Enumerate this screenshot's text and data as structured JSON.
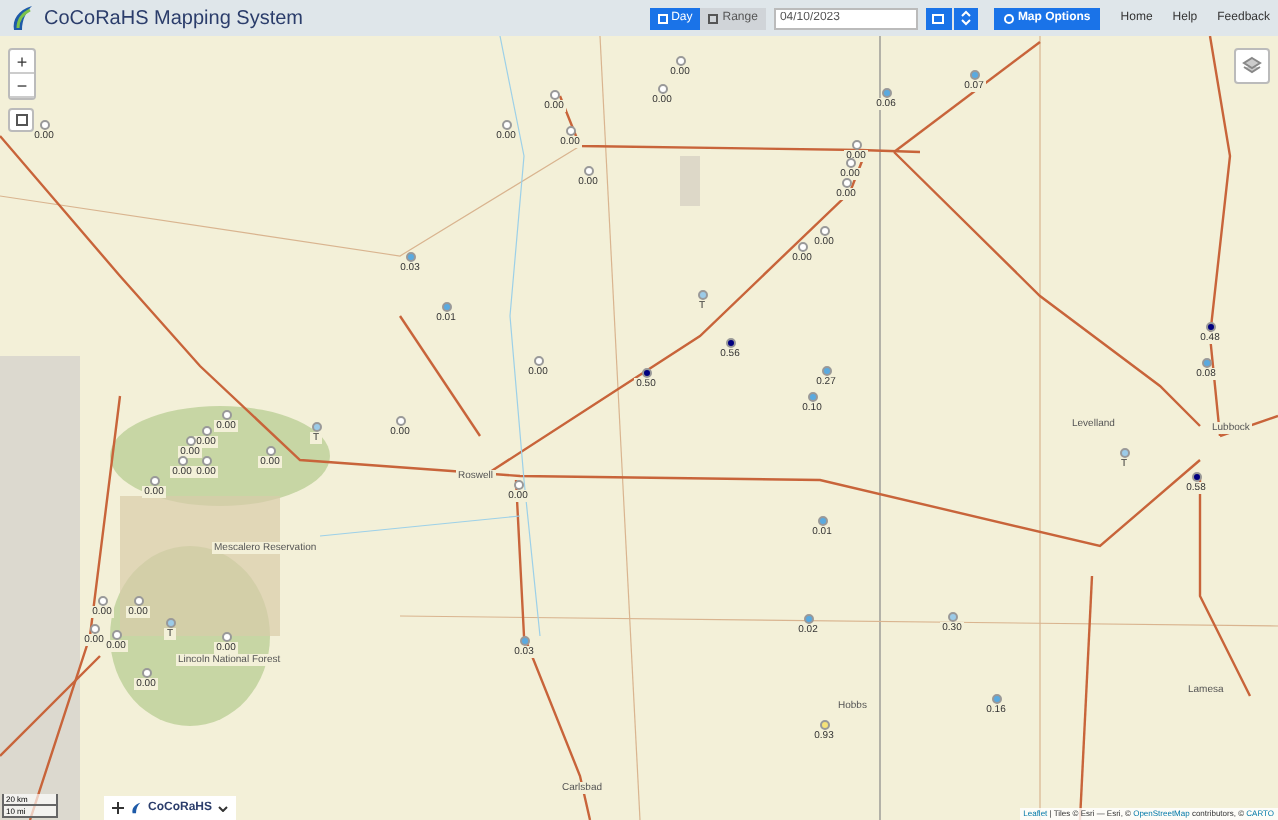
{
  "header": {
    "title": "CoCoRaHS Mapping System",
    "mode_tabs": [
      {
        "label": "Day",
        "selected": true
      },
      {
        "label": "Range",
        "selected": false
      }
    ],
    "date_field": {
      "value": "04/10/2023"
    },
    "map_options_button": "Map Options",
    "nav_links": [
      "Home",
      "Help",
      "Feedback"
    ]
  },
  "map": {
    "zoom_controls": [
      "+",
      "−"
    ],
    "markers": [
      {
        "value": "0.00",
        "color": "#ffffff"
      },
      {
        "value": "0.00",
        "color": "#ffffff"
      },
      {
        "value": "0.00",
        "color": "#ffffff"
      },
      {
        "value": "0.00",
        "color": "#ffffff"
      },
      {
        "value": "0.00",
        "color": "#ffffff"
      },
      {
        "value": "0.00",
        "color": "#ffffff"
      },
      {
        "value": "0.00",
        "color": "#ffffff"
      },
      {
        "value": "0.03",
        "color": "#5aaae0"
      },
      {
        "value": "0.01",
        "color": "#5aaae0"
      },
      {
        "value": "0.00",
        "color": "#ffffff"
      },
      {
        "value": "T",
        "color": "#9ccbe8"
      },
      {
        "value": "0.56",
        "color": "#000080"
      },
      {
        "value": "0.50",
        "color": "#000080"
      },
      {
        "value": "0.27",
        "color": "#5aaae0"
      },
      {
        "value": "0.10",
        "color": "#5aaae0"
      },
      {
        "value": "0.00",
        "color": "#ffffff"
      },
      {
        "value": "0.00",
        "color": "#ffffff"
      },
      {
        "value": "0.06",
        "color": "#5aaae0"
      },
      {
        "value": "0.07",
        "color": "#5aaae0"
      },
      {
        "value": "0.00",
        "color": "#ffffff"
      },
      {
        "value": "0.00",
        "color": "#ffffff"
      },
      {
        "value": "0.00",
        "color": "#ffffff"
      },
      {
        "value": "0.48",
        "color": "#000080"
      },
      {
        "value": "0.08",
        "color": "#5aaae0"
      },
      {
        "value": "T",
        "color": "#9ccbe8"
      },
      {
        "value": "0.01",
        "color": "#5aaae0"
      },
      {
        "value": "0.02",
        "color": "#5aaae0"
      },
      {
        "value": "0.30",
        "color": "#9ccbe8"
      },
      {
        "value": "0.16",
        "color": "#5aaae0"
      },
      {
        "value": "0.93",
        "color": "#f5e27a"
      },
      {
        "value": "0.03",
        "color": "#5aaae0"
      },
      {
        "value": "0.00",
        "color": "#ffffff"
      },
      {
        "value": "0.00",
        "color": "#ffffff"
      },
      {
        "value": "T",
        "color": "#9ccbe8"
      },
      {
        "value": "0.00",
        "color": "#ffffff"
      },
      {
        "value": "0.00",
        "color": "#ffffff"
      },
      {
        "value": "0.00",
        "color": "#ffffff"
      },
      {
        "value": "0.00",
        "color": "#ffffff"
      },
      {
        "value": "0.00",
        "color": "#ffffff"
      },
      {
        "value": "0.00",
        "color": "#ffffff"
      },
      {
        "value": "0.00",
        "color": "#ffffff"
      },
      {
        "value": "0.00",
        "color": "#ffffff"
      },
      {
        "value": "0.00",
        "color": "#ffffff"
      },
      {
        "value": "0.00",
        "color": "#ffffff"
      },
      {
        "value": "0.00",
        "color": "#ffffff"
      },
      {
        "value": "T",
        "color": "#9ccbe8"
      },
      {
        "value": "0.00",
        "color": "#ffffff"
      },
      {
        "value": "0.00",
        "color": "#ffffff"
      },
      {
        "value": "0.58",
        "color": "#000080"
      }
    ],
    "place_labels": [
      "Levelland",
      "Lubbock",
      "Lamesa",
      "Carlsbad",
      "Hobbs",
      "Roswell",
      "Mescalero Reservation",
      "Lincoln National Forest"
    ],
    "scale": [
      "20 km",
      "10 mi"
    ],
    "legend_control": {
      "label": "CoCoRaHS"
    },
    "attribution": [
      {
        "text": "Leaflet",
        "link": true
      },
      {
        "text": " | Tiles © Esri — Esri, © ",
        "link": false
      },
      {
        "text": "OpenStreetMap",
        "link": true
      },
      {
        "text": " contributors, © ",
        "link": false
      },
      {
        "text": "CARTO",
        "link": true
      }
    ]
  }
}
